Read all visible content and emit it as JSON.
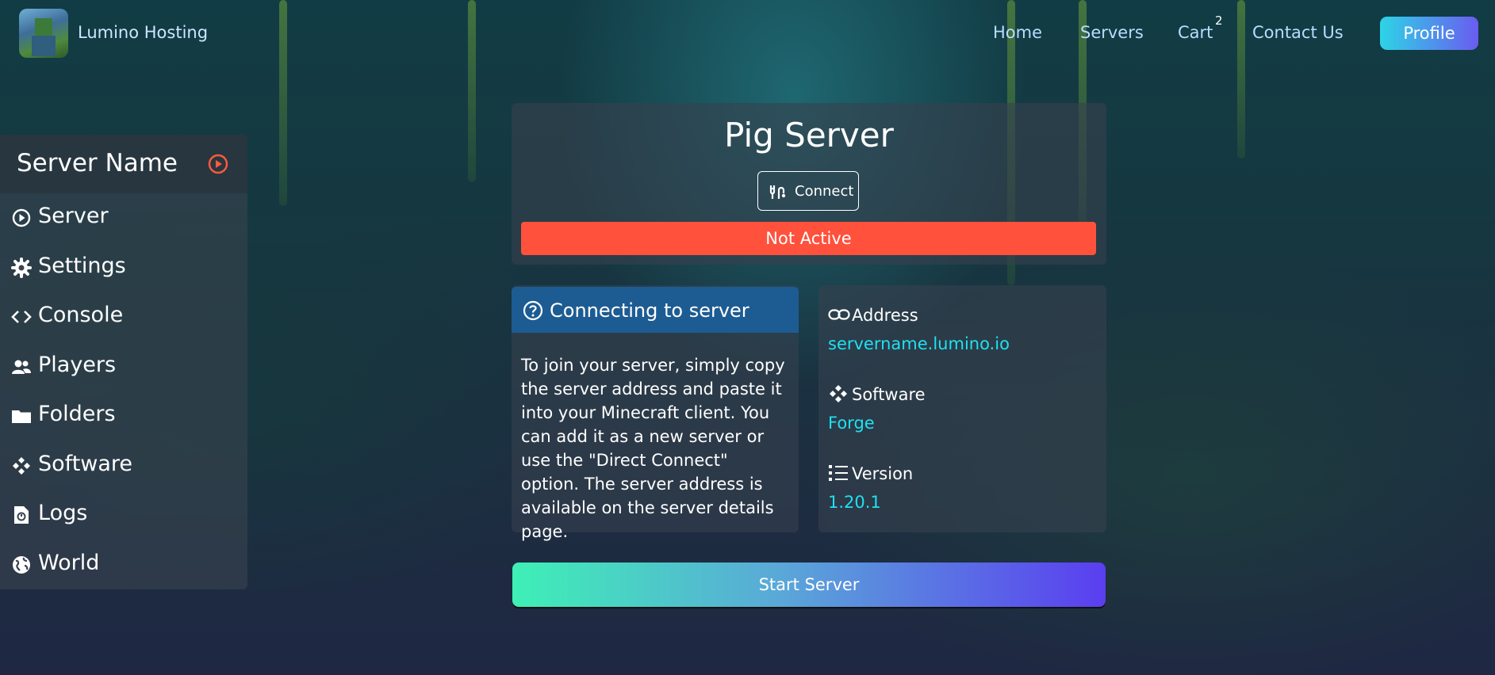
{
  "brand": {
    "name": "Lumino Hosting"
  },
  "nav": {
    "home": "Home",
    "servers": "Servers",
    "cart": "Cart",
    "cart_count": "2",
    "contact": "Contact Us",
    "profile": "Profile"
  },
  "sidebar": {
    "title": "Server Name",
    "items": [
      {
        "label": "Server",
        "icon": "play-circle-icon"
      },
      {
        "label": "Settings",
        "icon": "gear-icon"
      },
      {
        "label": "Console",
        "icon": "code-icon"
      },
      {
        "label": "Players",
        "icon": "users-icon"
      },
      {
        "label": "Folders",
        "icon": "folder-icon"
      },
      {
        "label": "Software",
        "icon": "diamond-nodes-icon"
      },
      {
        "label": "Logs",
        "icon": "file-history-icon"
      },
      {
        "label": "World",
        "icon": "globe-icon"
      }
    ]
  },
  "server": {
    "title": "Pig Server",
    "connect_label": "Connect",
    "status": "Not Active"
  },
  "info": {
    "heading": "Connecting to server",
    "body": "To join your server, simply copy the server address and paste it into your Minecraft client. You can add it as a new server or use the \"Direct Connect\" option. The server address is available on the server details page."
  },
  "details": {
    "address_label": "Address",
    "address_value": "servername.lumino.io",
    "software_label": "Software",
    "software_value": "Forge",
    "version_label": "Version",
    "version_value": "1.20.1"
  },
  "actions": {
    "start": "Start Server"
  },
  "colors": {
    "status_red": "#ff513c",
    "accent_cyan": "#20e0f0",
    "info_blue": "#1d5c93"
  }
}
